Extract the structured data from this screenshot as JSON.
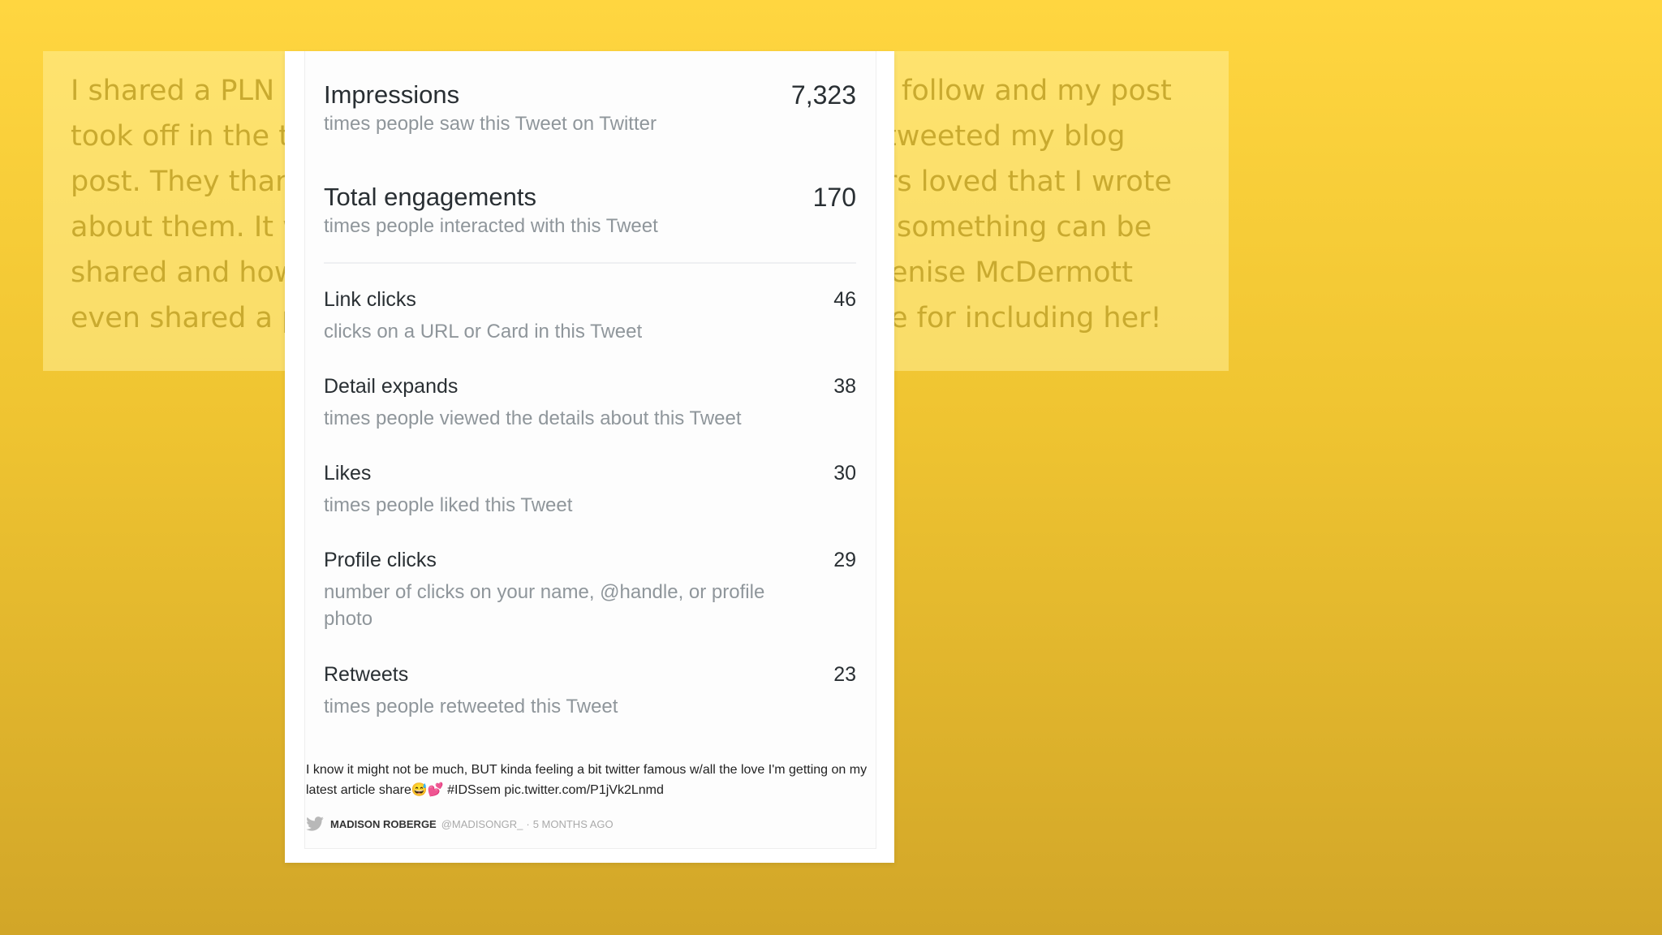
{
  "background_text": {
    "left_lines": [
      "I shared a PLN p",
      "took off in the t",
      "post. They than",
      "about them. It w",
      "shared and how",
      "even shared a p"
    ],
    "right_lines": [
      "follow and my post",
      "tweeted my blog",
      "rs loved that I wrote",
      "something can be",
      "enise McDermott",
      "e for including her!"
    ]
  },
  "analytics": {
    "impressions": {
      "label": "Impressions",
      "value": "7,323",
      "desc": "times people saw this Tweet on Twitter"
    },
    "total_engagements": {
      "label": "Total engagements",
      "value": "170",
      "desc": "times people interacted with this Tweet"
    },
    "rows": [
      {
        "label": "Link clicks",
        "value": "46",
        "desc": "clicks on a URL or Card in this Tweet"
      },
      {
        "label": "Detail expands",
        "value": "38",
        "desc": "times people viewed the details about this Tweet"
      },
      {
        "label": "Likes",
        "value": "30",
        "desc": "times people liked this Tweet"
      },
      {
        "label": "Profile clicks",
        "value": "29",
        "desc": "number of clicks on your name, @handle, or profile photo"
      },
      {
        "label": "Retweets",
        "value": "23",
        "desc": "times people retweeted this Tweet"
      }
    ]
  },
  "tweet": {
    "text": "I know it might not be much, BUT kinda feeling a bit twitter famous w/all the love I'm getting on my latest article share😅💕 #IDSsem pic.twitter.com/P1jVk2Lnmd",
    "author": "MADISON ROBERGE",
    "handle": "@MADISONGR_",
    "separator": "·",
    "time": "5 MONTHS AGO"
  },
  "colors": {
    "twitter_bird": "#b8b8b8",
    "background": "#f7cf3a"
  }
}
